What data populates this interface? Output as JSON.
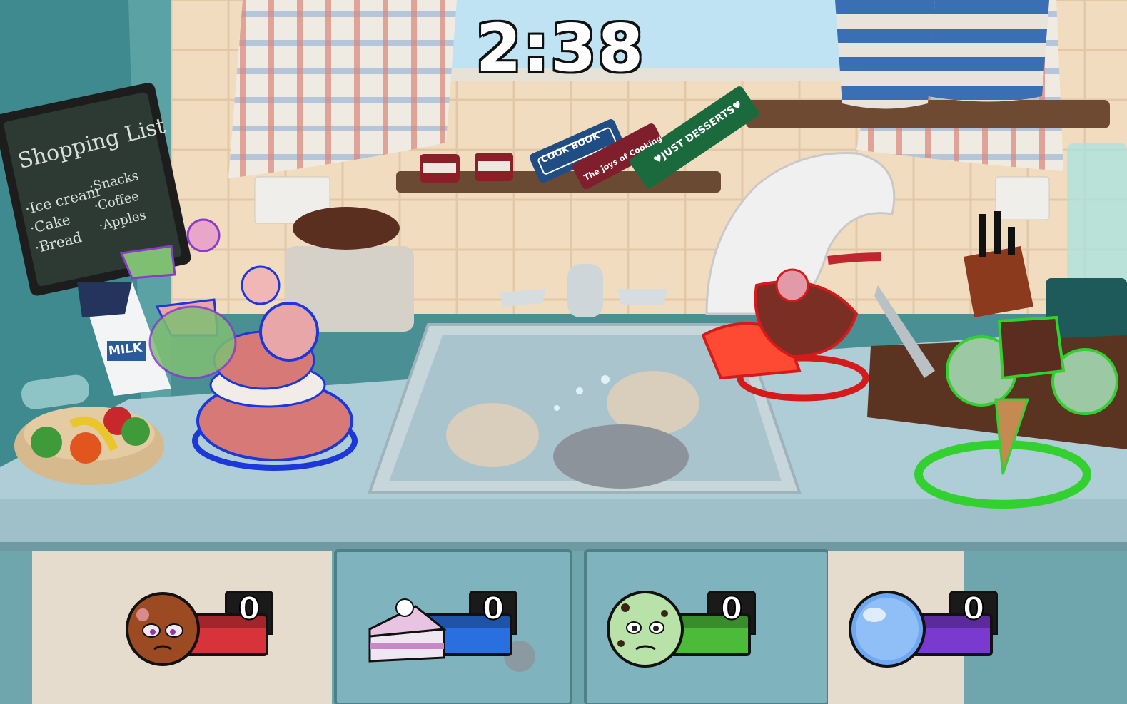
{
  "hud": {
    "timer": "2:38",
    "players": [
      {
        "character": "chocolate-cookie",
        "score": "0",
        "color": "#d8323a"
      },
      {
        "character": "strawberry-cake",
        "score": "0",
        "color": "#2a6fe0"
      },
      {
        "character": "mint-chip-ice-cream",
        "score": "0",
        "color": "#4cbb3a"
      },
      {
        "character": "bubble",
        "score": "0",
        "color": "#7a3ad0"
      }
    ]
  },
  "scene": {
    "chalkboard": {
      "title": "Shopping List",
      "items_left": [
        "·Ice cream",
        "·Cake",
        "·Bread"
      ],
      "items_right": [
        "·Snacks",
        "·Coffee",
        "·Apples"
      ]
    },
    "books": [
      "COOK BOOK",
      "The joys of Cooking",
      "♥JUST DESSERTS♥"
    ],
    "milk_carton": "MILK"
  },
  "colors": {
    "wall": "#f2dcc0",
    "counter": "#aecdd6",
    "cabinet": "#7fb4be",
    "p1": "#d8323a",
    "p2": "#2a6fe0",
    "p3": "#4cbb3a",
    "p4": "#7a3ad0"
  }
}
